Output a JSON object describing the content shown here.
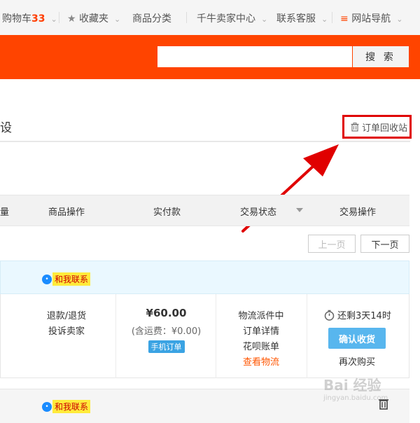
{
  "topnav": {
    "cart_label": "购物车",
    "cart_count": "33",
    "favorites": "收藏夹",
    "categories": "商品分类",
    "seller_center": "千牛卖家中心",
    "customer_service": "联系客服",
    "site_nav": "网站导航"
  },
  "search": {
    "value": "",
    "button": "搜 索"
  },
  "heading": {
    "title": "设",
    "recycle_bin": "订单回收站"
  },
  "table_header": {
    "quantity": "量",
    "product_ops": "商品操作",
    "paid": "实付款",
    "status": "交易状态",
    "trade_ops": "交易操作"
  },
  "pager": {
    "prev": "上一页",
    "next": "下一页"
  },
  "order": {
    "contact": "和我联系",
    "product_ops": [
      "退款/退货",
      "投诉卖家"
    ],
    "price": "¥60.00",
    "shipping": "(含运费：¥0.00)",
    "mobile_badge": "手机订单",
    "status_lines": [
      "物流派件中",
      "订单详情",
      "花呗账单"
    ],
    "view_logistics": "查看物流",
    "countdown": "还剩3天14时",
    "confirm_button": "确认收货",
    "rebuy": "再次购买"
  },
  "order2": {
    "contact": "和我联系"
  },
  "watermark": {
    "text": "Bai 经验",
    "sub": "jingyan.baidu.com"
  },
  "colors": {
    "accent": "#ff4400",
    "highlight": "#e00000",
    "link": "#ff5500",
    "button": "#58b6ee"
  }
}
